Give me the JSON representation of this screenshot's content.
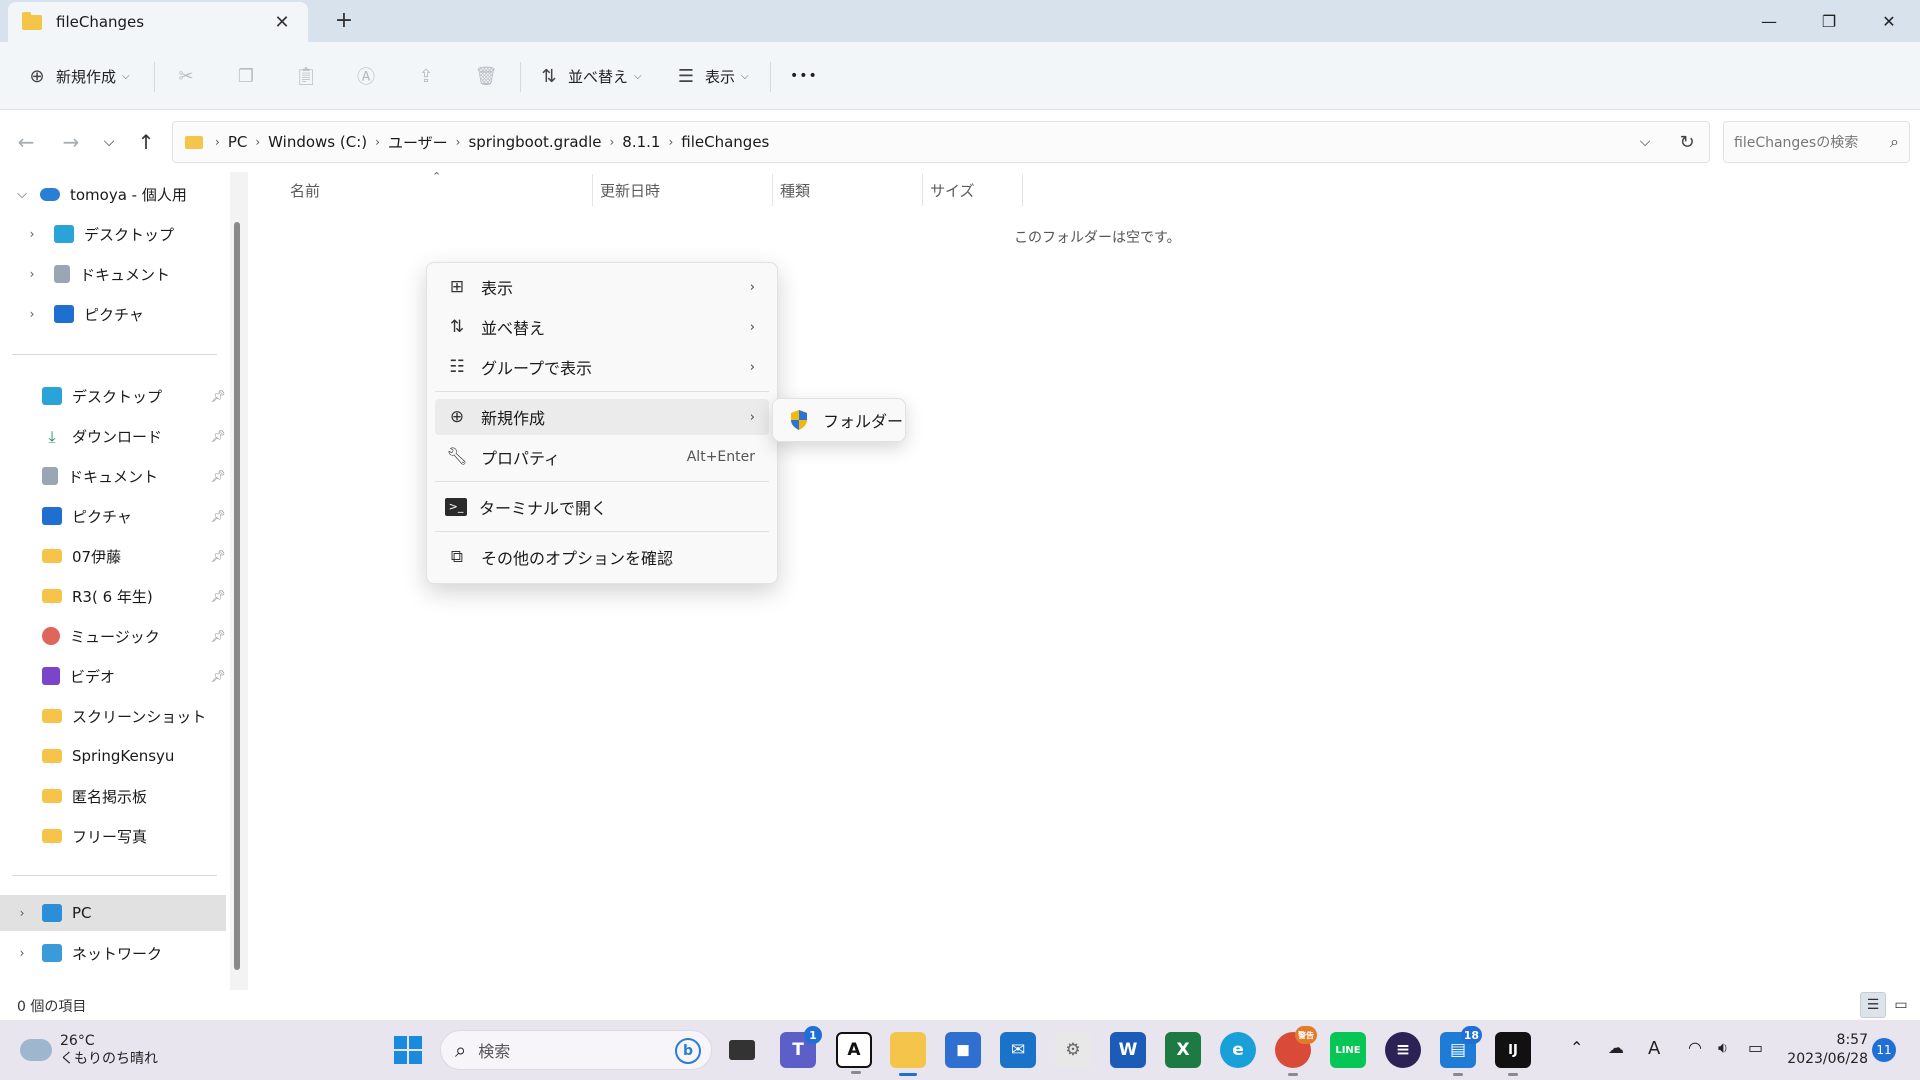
{
  "window": {
    "tab_title": "fileChanges",
    "new_tab": "+",
    "tab_close": "✕",
    "minimize": "—",
    "maximize": "❐",
    "close": "✕"
  },
  "toolbar": {
    "new_label": "新規作成",
    "sort_label": "並べ替え",
    "view_label": "表示",
    "more": "•••"
  },
  "address": {
    "crumbs": [
      "PC",
      "Windows (C:)",
      "ユーザー",
      "springboot.gradle",
      "8.1.1",
      "fileChanges"
    ],
    "search_placeholder": "fileChangesの検索"
  },
  "sidebar": {
    "account": "tomoya - 個人用",
    "tree": [
      "デスクトップ",
      "ドキュメント",
      "ピクチャ"
    ],
    "quick": [
      "デスクトップ",
      "ダウンロード",
      "ドキュメント",
      "ピクチャ",
      "07伊藤",
      "R3( 6 年生)",
      "ミュージック",
      "ビデオ",
      "スクリーンショット",
      "SpringKensyu",
      "匿名掲示板",
      "フリー写真"
    ],
    "pc": "PC",
    "network": "ネットワーク"
  },
  "columns": {
    "name": "名前",
    "modified": "更新日時",
    "type": "種類",
    "size": "サイズ"
  },
  "empty_message": "このフォルダーは空です。",
  "context_menu": {
    "view": "表示",
    "sort": "並べ替え",
    "group": "グループで表示",
    "new": "新規作成",
    "properties": "プロパティ",
    "properties_shortcut": "Alt+Enter",
    "terminal": "ターミナルで開く",
    "more_options": "その他のオプションを確認"
  },
  "submenu": {
    "folder": "フォルダー"
  },
  "status": {
    "items": "0 個の項目"
  },
  "taskbar": {
    "weather_temp": "26°C",
    "weather_desc": "くもりのち晴れ",
    "search": "検索",
    "teams_badge": "1",
    "chrome_badge": "警告",
    "store_badge": "18",
    "time": "8:57",
    "date": "2023/06/28",
    "notifications": "11"
  },
  "colors": {
    "titlebar": "#d7e2ec",
    "toolbar": "#f3f6f9",
    "accent": "#1f6fd6",
    "folder": "#f4c54a",
    "taskbar": "#e9e5ef"
  }
}
